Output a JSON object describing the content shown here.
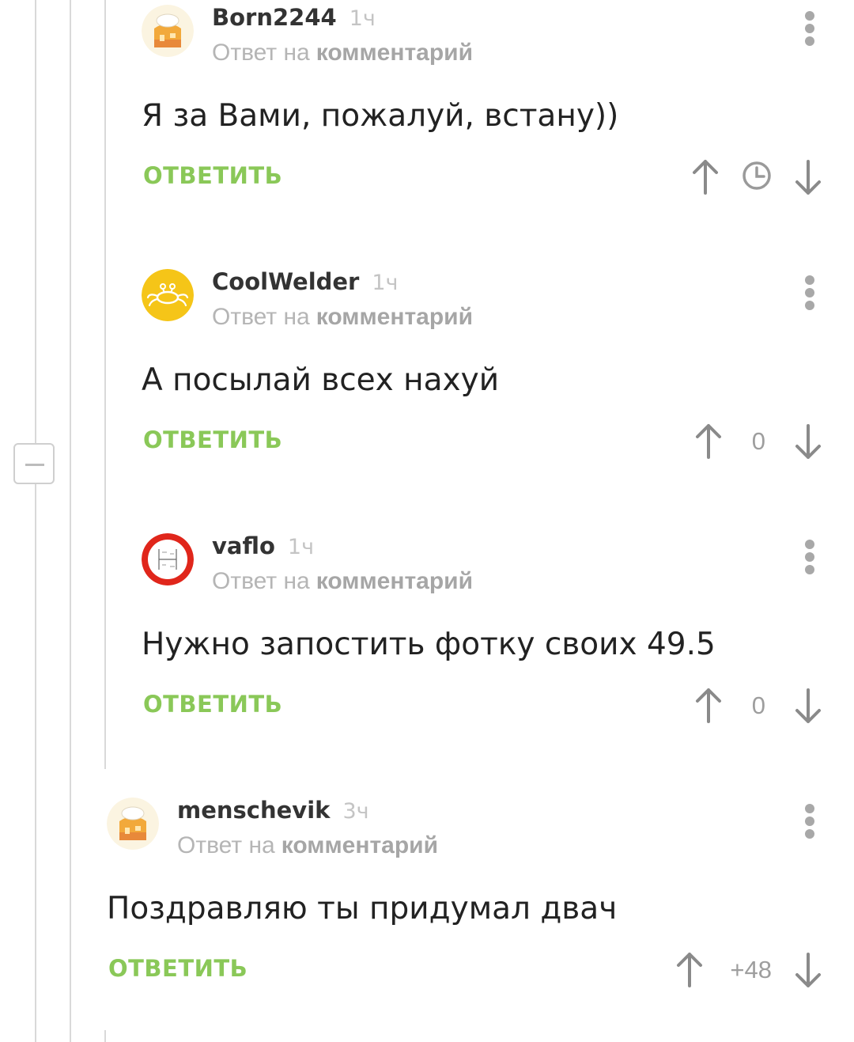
{
  "comments": [
    {
      "author": "Born2244",
      "time": "1ч",
      "reply_prefix": "Ответ на",
      "reply_target": "комментарий",
      "text": "Я за Вами, пожалуй, встану))",
      "reply_label": "ОТВЕТИТЬ",
      "rating": "",
      "rating_icon": "clock-icon",
      "avatar_icon": "chef-house-avatar"
    },
    {
      "author": "CoolWelder",
      "time": "1ч",
      "reply_prefix": "Ответ на",
      "reply_target": "комментарий",
      "text": "А посылай всех нахуй",
      "reply_label": "ОТВЕТИТЬ",
      "rating": "0",
      "avatar_icon": "crab-avatar"
    },
    {
      "author": "vaflo",
      "time": "1ч",
      "reply_prefix": "Ответ на",
      "reply_target": "комментарий",
      "text": "Нужно запостить фотку своих 49.5",
      "reply_label": "ОТВЕТИТЬ",
      "rating": "0",
      "avatar_icon": "red-ring-avatar"
    },
    {
      "author": "menschevik",
      "time": "3ч",
      "reply_prefix": "Ответ на",
      "reply_target": "комментарий",
      "text": "Поздравляю ты придумал двач",
      "reply_label": "ОТВЕТИТЬ",
      "rating": "+48",
      "avatar_icon": "chef-house-avatar"
    }
  ],
  "colors": {
    "accent_green": "#8ac858",
    "text_dark": "#222222",
    "meta_gray": "#b5b5b5",
    "thread_line": "#d9d9d9",
    "avatar_yellow": "#f5c518",
    "avatar_red": "#e0261b"
  }
}
